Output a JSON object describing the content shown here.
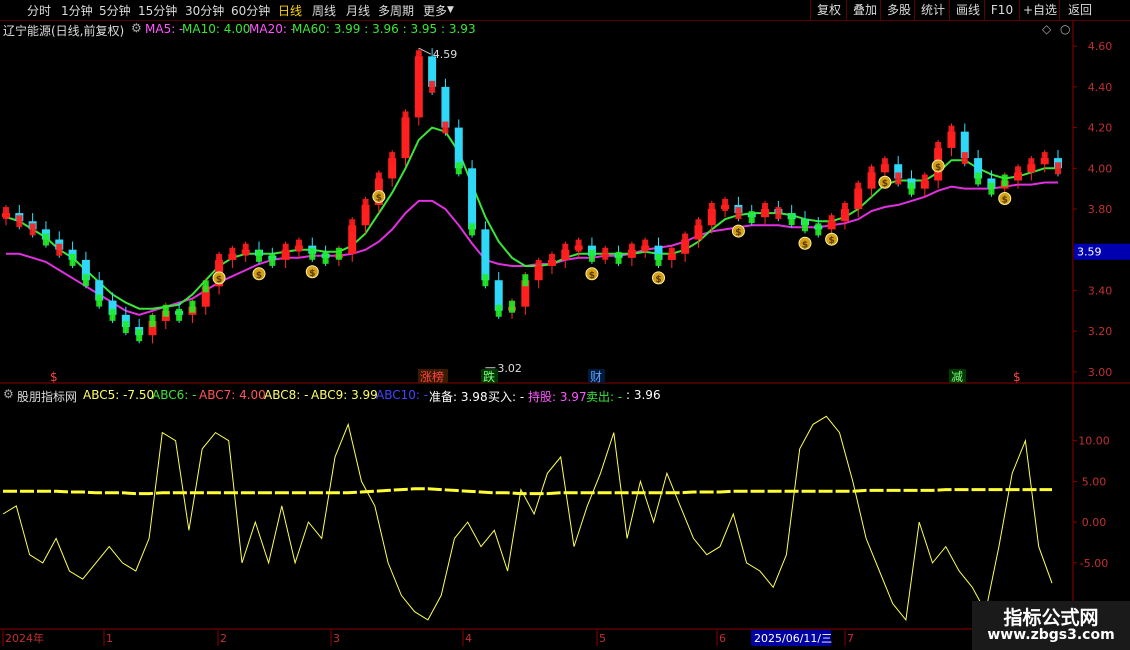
{
  "toolbar": {
    "periods": [
      {
        "label": "分时",
        "active": false
      },
      {
        "label": "1分钟",
        "active": false
      },
      {
        "label": "5分钟",
        "active": false
      },
      {
        "label": "15分钟",
        "active": false
      },
      {
        "label": "30分钟",
        "active": false
      },
      {
        "label": "60分钟",
        "active": false
      },
      {
        "label": "日线",
        "active": true
      },
      {
        "label": "周线",
        "active": false
      },
      {
        "label": "月线",
        "active": false
      },
      {
        "label": "多周期",
        "active": false
      },
      {
        "label": "更多",
        "active": false
      }
    ],
    "more_arrow": "▼",
    "right": [
      "复权",
      "叠加",
      "多股",
      "统计",
      "画线",
      "F10",
      "+自选",
      "返回"
    ]
  },
  "main": {
    "title": "辽宁能源(日线,前复权)",
    "ma": [
      {
        "label": "MA5: -",
        "color": "#ff55ff"
      },
      {
        "label": "MA10: 4.00",
        "color": "#39e639"
      },
      {
        "label": "MA20: -",
        "color": "#ff55ff"
      },
      {
        "label": "MA60: 3.99 : 3.96 : 3.95 : 3.93",
        "color": "#39e639"
      }
    ],
    "y_ticks": [
      "4.60",
      "4.40",
      "4.20",
      "4.00",
      "3.80",
      "3.60",
      "3.40",
      "3.20",
      "3.00"
    ],
    "current_price": "3.59",
    "high_marker": "4.59",
    "low_marker": "3.02",
    "signals": [
      {
        "text": "涨榜",
        "color": "#ff4444",
        "bg": "#3a1a00"
      },
      {
        "text": "跌",
        "color": "#7cff7c",
        "bg": "#003a00"
      },
      {
        "text": "财",
        "color": "#5aa0ff",
        "bg": "#001a3a"
      },
      {
        "text": "减",
        "color": "#7cff7c",
        "bg": "#003a00"
      },
      {
        "text": "$",
        "color": "#ff4444",
        "bg": "transparent"
      },
      {
        "text": "$",
        "color": "#ff4444",
        "bg": "transparent"
      }
    ],
    "bag_icon": "$"
  },
  "indicator": {
    "name": "股朋指标网",
    "values": [
      {
        "label": "ABC5: -7.50",
        "color": "#ffff66"
      },
      {
        "label": "ABC6: -",
        "color": "#39e639"
      },
      {
        "label": "ABC7: 4.00",
        "color": "#ff5555"
      },
      {
        "label": "ABC8: -",
        "color": "#ffff66"
      },
      {
        "label": "ABC9: 3.99",
        "color": "#ffff66"
      },
      {
        "label": "ABC10: -",
        "color": "#4444ff"
      },
      {
        "label": "准备: 3.98",
        "color": "#ffffff"
      },
      {
        "label": "买入: -",
        "color": "#ffffff"
      },
      {
        "label": "持股: 3.97",
        "color": "#ff55ff"
      },
      {
        "label": "卖出: -",
        "color": "#39e639"
      },
      {
        "label": ": 3.96",
        "color": "#ffffff"
      }
    ],
    "y_ticks": [
      "10.00",
      "5.00",
      "0.00",
      "-5.00"
    ]
  },
  "time_axis": {
    "labels": [
      "2024年",
      "1",
      "2",
      "3",
      "4",
      "5",
      "6",
      "2025/06/11/三",
      "7"
    ]
  },
  "watermark": {
    "line1": "指标公式网",
    "line2": "www.zbgs3.com"
  },
  "chart_data": {
    "type": "candlestick",
    "title": "辽宁能源(日线,前复权)",
    "ylim": [
      2.95,
      4.65
    ],
    "yticks": [
      3.0,
      3.2,
      3.4,
      3.6,
      3.8,
      4.0,
      4.2,
      4.4,
      4.6
    ],
    "x_months": [
      "2024年",
      "1",
      "2",
      "3",
      "4",
      "5",
      "6",
      "7"
    ],
    "high": 4.59,
    "low": 3.02,
    "last_price": 3.59,
    "price_series_close": [
      3.78,
      3.74,
      3.7,
      3.65,
      3.6,
      3.55,
      3.45,
      3.35,
      3.28,
      3.22,
      3.18,
      3.25,
      3.3,
      3.28,
      3.32,
      3.42,
      3.55,
      3.58,
      3.6,
      3.57,
      3.55,
      3.6,
      3.62,
      3.58,
      3.56,
      3.58,
      3.72,
      3.82,
      3.95,
      4.05,
      4.25,
      4.55,
      4.4,
      4.2,
      4.0,
      3.7,
      3.45,
      3.3,
      3.32,
      3.45,
      3.52,
      3.55,
      3.6,
      3.62,
      3.57,
      3.58,
      3.56,
      3.6,
      3.62,
      3.55,
      3.58,
      3.65,
      3.72,
      3.8,
      3.82,
      3.78,
      3.76,
      3.8,
      3.78,
      3.75,
      3.72,
      3.7,
      3.74,
      3.8,
      3.9,
      3.98,
      4.02,
      3.95,
      3.9,
      3.94,
      4.1,
      4.18,
      4.05,
      3.95,
      3.9,
      3.94,
      3.98,
      4.02,
      4.05,
      4.0
    ],
    "ma60": [
      3.58,
      3.58,
      3.56,
      3.54,
      3.5,
      3.46,
      3.42,
      3.38,
      3.34,
      3.3,
      3.28,
      3.3,
      3.32,
      3.34,
      3.36,
      3.4,
      3.44,
      3.47,
      3.5,
      3.53,
      3.55,
      3.56,
      3.56,
      3.57,
      3.57,
      3.57,
      3.58,
      3.6,
      3.64,
      3.7,
      3.78,
      3.84,
      3.84,
      3.8,
      3.72,
      3.63,
      3.55,
      3.53,
      3.52,
      3.52,
      3.53,
      3.53,
      3.55,
      3.56,
      3.56,
      3.57,
      3.57,
      3.58,
      3.6,
      3.61,
      3.62,
      3.64,
      3.67,
      3.69,
      3.7,
      3.71,
      3.72,
      3.72,
      3.72,
      3.71,
      3.71,
      3.71,
      3.72,
      3.73,
      3.75,
      3.79,
      3.81,
      3.82,
      3.84,
      3.86,
      3.89,
      3.91,
      3.9,
      3.9,
      3.9,
      3.91,
      3.92,
      3.92,
      3.93,
      3.93
    ],
    "ma10": [
      3.76,
      3.74,
      3.7,
      3.66,
      3.6,
      3.56,
      3.5,
      3.44,
      3.38,
      3.34,
      3.31,
      3.31,
      3.32,
      3.33,
      3.38,
      3.45,
      3.52,
      3.56,
      3.58,
      3.58,
      3.58,
      3.59,
      3.6,
      3.6,
      3.59,
      3.59,
      3.62,
      3.68,
      3.78,
      3.88,
      4.0,
      4.14,
      4.2,
      4.18,
      4.08,
      3.92,
      3.76,
      3.64,
      3.56,
      3.52,
      3.52,
      3.53,
      3.56,
      3.58,
      3.58,
      3.58,
      3.58,
      3.58,
      3.59,
      3.58,
      3.58,
      3.6,
      3.64,
      3.7,
      3.75,
      3.77,
      3.78,
      3.78,
      3.78,
      3.77,
      3.75,
      3.74,
      3.74,
      3.76,
      3.8,
      3.86,
      3.92,
      3.94,
      3.94,
      3.94,
      3.98,
      4.04,
      4.04,
      4.0,
      3.97,
      3.95,
      3.96,
      3.98,
      4.0,
      4.0
    ]
  },
  "indicator_data": {
    "type": "line",
    "ylim": [
      -13,
      15
    ],
    "abc5": [
      1,
      2,
      -4,
      -5,
      -2,
      -6,
      -7,
      -5,
      -3,
      -5,
      -6,
      -2,
      11,
      10,
      -1,
      9,
      11,
      10,
      -5,
      0,
      -5,
      2,
      -5,
      0,
      -2,
      8,
      12,
      5,
      2,
      -5,
      -9,
      -11,
      -12,
      -9,
      -2,
      0,
      -3,
      -1,
      -6,
      4,
      1,
      6,
      8,
      -3,
      2,
      6,
      11,
      -2,
      5,
      0,
      6,
      2,
      -2,
      -4,
      -3,
      1,
      -5,
      -6,
      -8,
      -4,
      9,
      12,
      13,
      11,
      5,
      -2,
      -6,
      -10,
      -12,
      0,
      -5,
      -3,
      -6,
      -8,
      -11,
      -3,
      6,
      10,
      -3,
      -7.5
    ],
    "ma_line": [
      3.8,
      3.8,
      3.8,
      3.8,
      3.8,
      3.7,
      3.7,
      3.6,
      3.6,
      3.6,
      3.5,
      3.5,
      3.6,
      3.6,
      3.6,
      3.6,
      3.6,
      3.6,
      3.6,
      3.6,
      3.6,
      3.6,
      3.6,
      3.6,
      3.6,
      3.6,
      3.6,
      3.7,
      3.8,
      3.9,
      4.0,
      4.1,
      4.1,
      4.0,
      3.9,
      3.8,
      3.7,
      3.6,
      3.6,
      3.5,
      3.5,
      3.5,
      3.6,
      3.6,
      3.6,
      3.6,
      3.6,
      3.6,
      3.6,
      3.6,
      3.6,
      3.6,
      3.7,
      3.7,
      3.7,
      3.8,
      3.8,
      3.8,
      3.8,
      3.8,
      3.8,
      3.8,
      3.8,
      3.8,
      3.8,
      3.9,
      3.9,
      3.9,
      3.9,
      3.9,
      3.9,
      4.0,
      4.0,
      4.0,
      4.0,
      4.0,
      4.0,
      4.0,
      4.0,
      4.0
    ]
  }
}
